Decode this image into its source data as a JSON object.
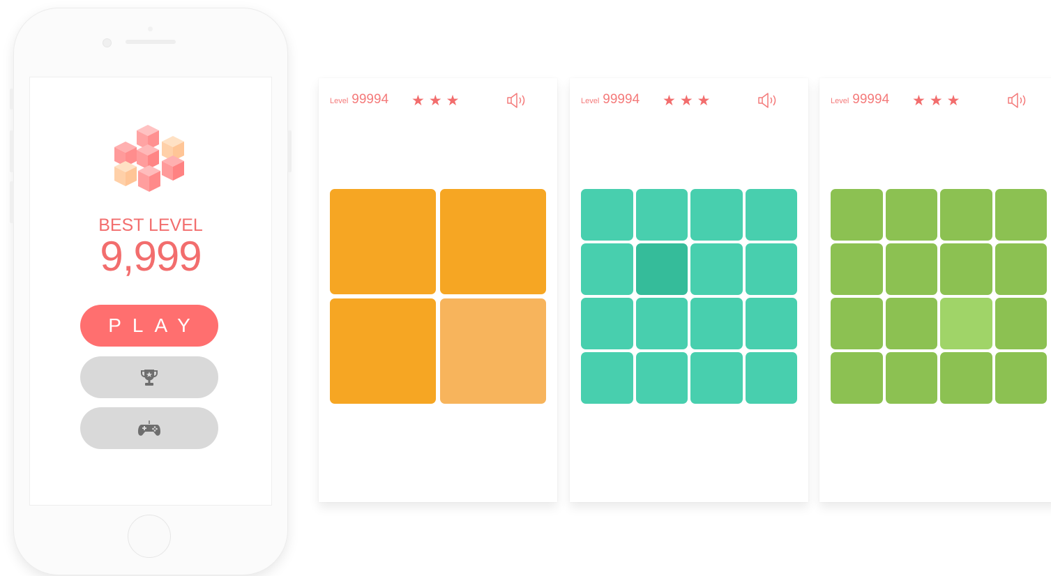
{
  "menu": {
    "best_label": "BEST LEVEL",
    "best_value": "9,999",
    "play_label": "PLAY",
    "trophy_icon": "trophy-icon",
    "gamepad_icon": "gamepad-icon"
  },
  "panels": [
    {
      "level_label": "Level",
      "level_value": "99994",
      "stars": "★★★",
      "grid": 2,
      "base_color": "#f6a623",
      "odd_color": "#f7b45c",
      "odd_index": 3
    },
    {
      "level_label": "Level",
      "level_value": "99994",
      "stars": "★★★",
      "grid": 4,
      "base_color": "#48cfae",
      "odd_color": "#35bc9a",
      "odd_index": 5
    },
    {
      "level_label": "Level",
      "level_value": "99994",
      "stars": "★★★",
      "grid": 4,
      "base_color": "#8cc152",
      "odd_color": "#a0d468",
      "odd_index": 10
    }
  ],
  "colors": {
    "accent": "#ff6f6f",
    "button_gray": "#d9d9d9"
  }
}
